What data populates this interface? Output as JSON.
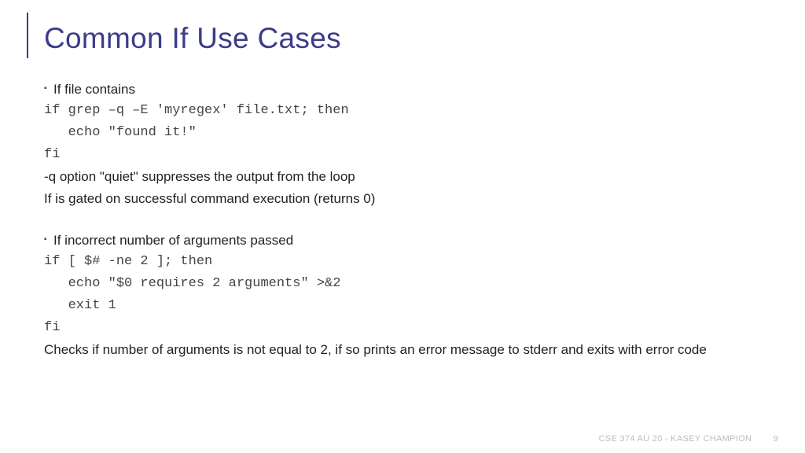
{
  "title": "Common If Use Cases",
  "section1": {
    "heading": "If file contains",
    "code": "if grep –q –E 'myregex' file.txt; then\n   echo \"found it!\"\nfi",
    "note1": "-q option \"quiet\" suppresses the output from the loop",
    "note2": "If is gated on successful command execution (returns 0)"
  },
  "section2": {
    "heading": "If incorrect number of arguments passed",
    "code": "if [ $# -ne 2 ]; then\n   echo \"$0 requires 2 arguments\" >&2\n   exit 1\nfi",
    "note1": "Checks if number of arguments is not equal to 2, if so prints an error message to stderr and exits with error code"
  },
  "footer": {
    "text": "CSE 374 AU 20 - KASEY CHAMPION",
    "page": "9"
  }
}
